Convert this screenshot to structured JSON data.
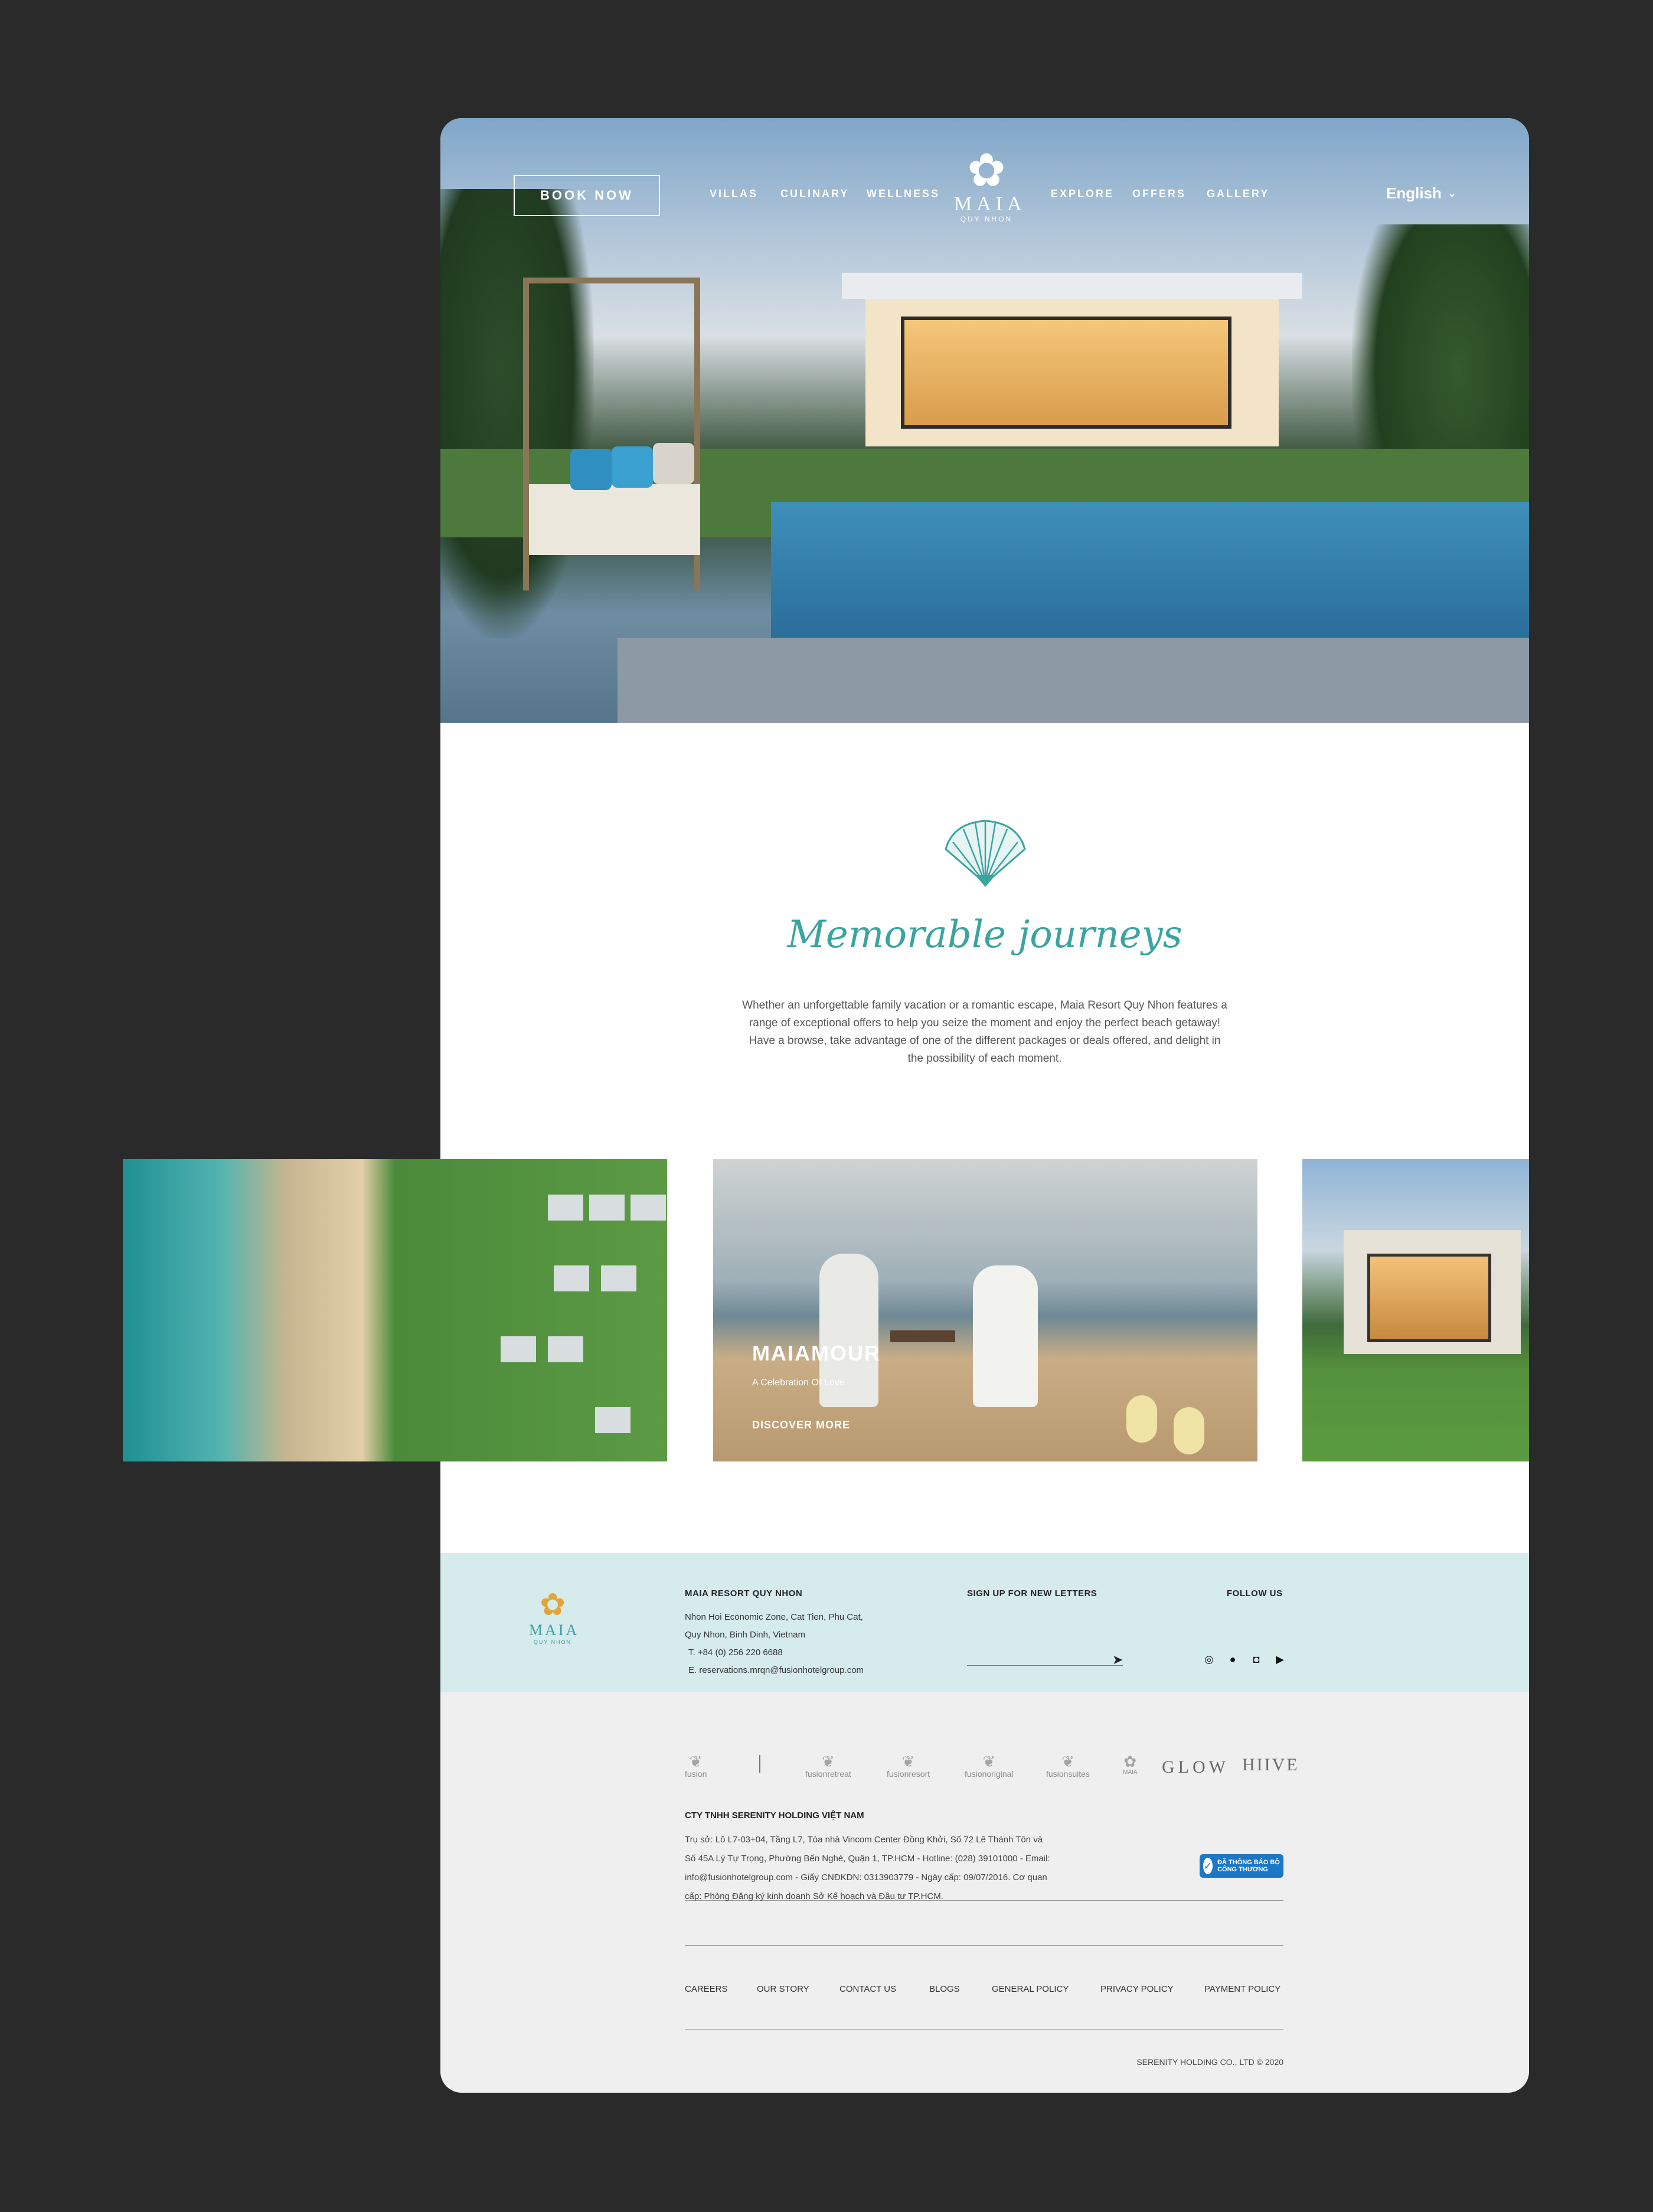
{
  "nav": {
    "book_now": "BOOK NOW",
    "links": [
      "VILLAS",
      "CULINARY",
      "WELLNESS",
      "EXPLORE",
      "OFFERS",
      "GALLERY"
    ],
    "language": "English",
    "logo_word": "MAIA",
    "logo_sub": "QUY NHON"
  },
  "intro": {
    "title": "Memorable journeys",
    "text": "Whether an unforgettable family vacation or a romantic escape, Maia Resort Quy Nhon features a range of exceptional offers to help you seize the moment and enjoy the perfect beach getaway! Have a browse, take advantage of one of the different packages or deals offered, and delight in the possibility of each moment."
  },
  "carousel": {
    "active_title": "MAIAMOUR",
    "active_subtitle": "A Celebration Of Love",
    "active_cta": "DISCOVER MORE"
  },
  "footer": {
    "logo_word": "MAIA",
    "logo_sub": "QUY NHON",
    "resort_title": "MAIA RESORT QUY NHON",
    "address_line1": "Nhon Hoi Economic Zone, Cat Tien, Phu Cat,",
    "address_line2": "Quy Nhon, Binh Dinh, Vietnam",
    "phone": "T.  +84 (0) 256 220 6688",
    "email": "E.  reservations.mrqn@fusionhotelgroup.com",
    "signup_title": "SIGN UP FOR NEW LETTERS",
    "follow_title": "FOLLOW US",
    "brands": [
      "fusion",
      "fusionretreat",
      "fusionresort",
      "fusionoriginal",
      "fusionsuites",
      "MAIA",
      "GLOW",
      "HIIVE"
    ],
    "company_title": "CTY TNHH SERENITY HOLDING VIỆT NAM",
    "company_text": "Trụ sở: Lô L7-03+04, Tầng L7, Tòa nhà Vincom Center Đồng Khởi, Số 72 Lê Thánh Tôn và Số 45A Lý Tự Trọng, Phường Bến Nghé, Quận 1, TP.HCM - Hotline: (028) 39101000 - Email: info@fusionhotelgroup.com - Giấy CNĐKDN: 0313903779 - Ngày cấp: 09/07/2016. Cơ quan cấp: Phòng Đăng ký kinh doanh Sở Kế hoạch và Đầu tư TP.HCM.",
    "badge_text": "ĐÃ THÔNG BÁO BỘ CÔNG THƯƠNG",
    "links": [
      "CAREERS",
      "OUR STORY",
      "CONTACT US",
      "BLOGS",
      "GENERAL POLICY",
      "PRIVACY POLICY",
      "PAYMENT POLICY"
    ],
    "copyright": "SERENITY HOLDING CO., LTD © 2020"
  }
}
